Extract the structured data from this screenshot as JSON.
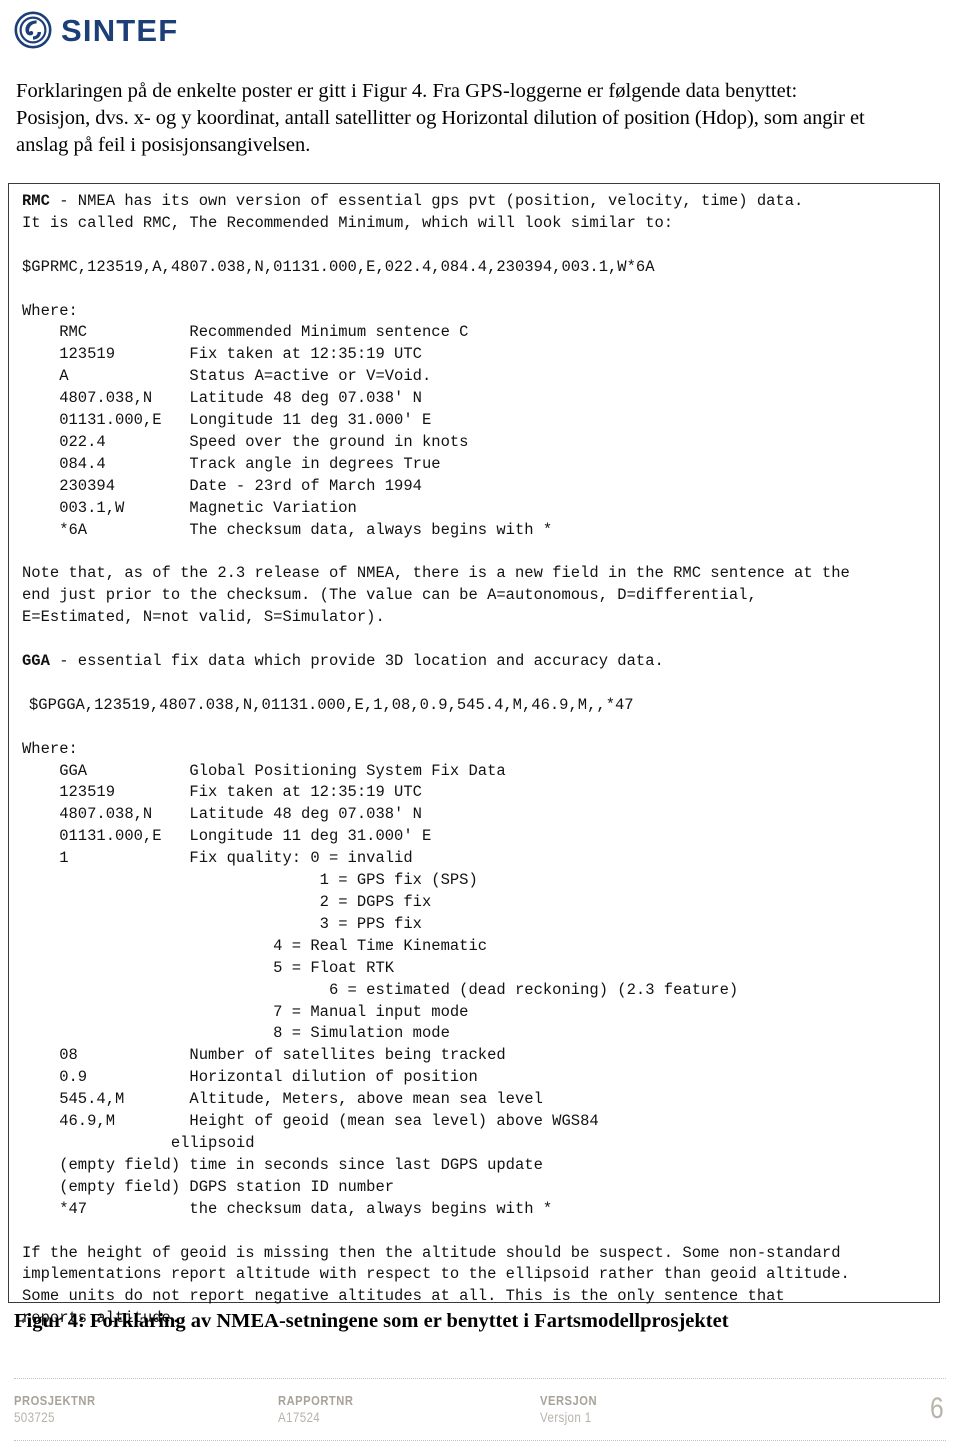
{
  "header": {
    "logo_icon": "sintef-circle-logo-icon",
    "wordmark": "SINTEF",
    "brand_color": "#1d3f78"
  },
  "intro": {
    "line_1": "Forklaringen på de enkelte poster er gitt i Figur 4. Fra GPS-loggerne er følgende data benyttet:",
    "line_2": "Posisjon, dvs. x- og y koordinat, antall satellitter og Horizontal dilution of position (Hdop), som angir et",
    "line_3": "anslag på feil i posisjonsangivelsen."
  },
  "nmea_box": {
    "rmc": {
      "heading_key": "RMC",
      "heading_rest": " - NMEA has its own version of essential gps pvt (position, velocity, time) data.",
      "heading_line2": "It is called RMC, The Recommended Minimum, which will look similar to:",
      "sentence": "$GPRMC,123519,A,4807.038,N,01131.000,E,022.4,084.4,230394,003.1,W*6A",
      "where_label": "Where:",
      "fields": [
        {
          "key": "RMC",
          "desc": "Recommended Minimum sentence C"
        },
        {
          "key": "123519",
          "desc": "Fix taken at 12:35:19 UTC"
        },
        {
          "key": "A",
          "desc": "Status A=active or V=Void."
        },
        {
          "key": "4807.038,N",
          "desc": "Latitude 48 deg 07.038' N"
        },
        {
          "key": "01131.000,E",
          "desc": "Longitude 11 deg 31.000' E"
        },
        {
          "key": "022.4",
          "desc": "Speed over the ground in knots"
        },
        {
          "key": "084.4",
          "desc": "Track angle in degrees True"
        },
        {
          "key": "230394",
          "desc": "Date - 23rd of March 1994"
        },
        {
          "key": "003.1,W",
          "desc": "Magnetic Variation"
        },
        {
          "key": "*6A",
          "desc": "The checksum data, always begins with *"
        }
      ],
      "note_line_1": "Note that, as of the 2.3 release of NMEA, there is a new field in the RMC sentence at the",
      "note_line_2": "end just prior to the checksum. (The value can be A=autonomous, D=differential,",
      "note_line_3": "E=Estimated, N=not valid, S=Simulator)."
    },
    "gga": {
      "heading_key": "GGA",
      "heading_rest": " - essential fix data which provide 3D location and accuracy data.",
      "sentence": "$GPGGA,123519,4807.038,N,01131.000,E,1,08,0.9,545.4,M,46.9,M,,*47",
      "where_label": "Where:",
      "fields": [
        {
          "key": "GGA",
          "desc": "Global Positioning System Fix Data"
        },
        {
          "key": "123519",
          "desc": "Fix taken at 12:35:19 UTC"
        },
        {
          "key": "4807.038,N",
          "desc": "Latitude 48 deg 07.038' N"
        },
        {
          "key": "01131.000,E",
          "desc": "Longitude 11 deg 31.000' E"
        },
        {
          "key": "1",
          "desc": "Fix quality: 0 = invalid"
        }
      ],
      "fix_quality": [
        {
          "indent": 32,
          "text": "1 = GPS fix (SPS)"
        },
        {
          "indent": 32,
          "text": "2 = DGPS fix"
        },
        {
          "indent": 32,
          "text": "3 = PPS fix"
        },
        {
          "indent": 27,
          "text": "4 = Real Time Kinematic"
        },
        {
          "indent": 27,
          "text": "5 = Float RTK"
        },
        {
          "indent": 33,
          "text": "6 = estimated (dead reckoning) (2.3 feature)"
        },
        {
          "indent": 27,
          "text": "7 = Manual input mode"
        },
        {
          "indent": 27,
          "text": "8 = Simulation mode"
        }
      ],
      "fields_tail": [
        {
          "key": "08",
          "desc": "Number of satellites being tracked"
        },
        {
          "key": "0.9",
          "desc": "Horizontal dilution of position"
        },
        {
          "key": "545.4,M",
          "desc": "Altitude, Meters, above mean sea level"
        },
        {
          "key": "46.9,M",
          "desc": "Height of geoid (mean sea level) above WGS84"
        },
        {
          "key": "",
          "desc": "            ellipsoid"
        },
        {
          "key": "(empty field)",
          "desc": "time in seconds since last DGPS update"
        },
        {
          "key": "(empty field)",
          "desc": "DGPS station ID number"
        },
        {
          "key": "*47",
          "desc": "the checksum data, always begins with *"
        }
      ],
      "closing_line_1": "If the height of geoid is missing then the altitude should be suspect. Some non-standard",
      "closing_line_2": "implementations report altitude with respect to the ellipsoid rather than geoid altitude.",
      "closing_line_3": "Some units do not report negative altitudes at all. This is the only sentence that",
      "closing_line_4": "reports altitude."
    }
  },
  "figure_caption": "Figur 4: Forklaring av NMEA-setningene som er benyttet i Fartsmodellprosjektet",
  "footer": {
    "columns": [
      {
        "label": "PROSJEKTNR",
        "value": "503725"
      },
      {
        "label": "RAPPORTNR",
        "value": "A17524"
      },
      {
        "label": "VERSJON",
        "value": "Versjon 1"
      }
    ],
    "page_number": "6"
  }
}
